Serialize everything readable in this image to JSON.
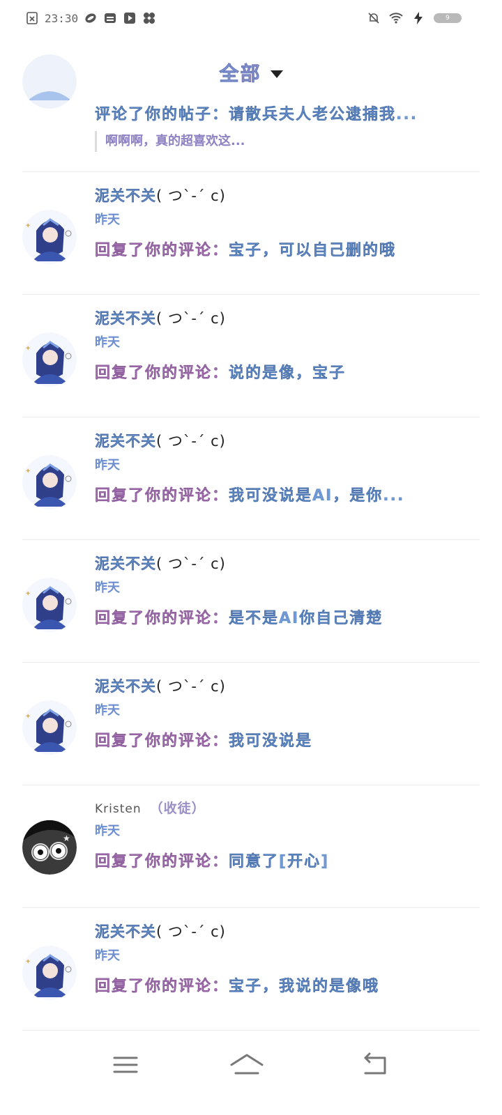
{
  "status_bar": {
    "time": "23:30",
    "left_icons": [
      "sim-x-icon",
      "app-icon",
      "calendar-icon",
      "video-icon",
      "fan-icon"
    ],
    "right_icons": [
      "mute-bell-icon",
      "wifi-icon",
      "charging-icon"
    ],
    "battery_label": "9"
  },
  "header": {
    "title": "全部",
    "back_icon": "chevron-left-icon",
    "dropdown_icon": "caret-down-icon"
  },
  "first_item": {
    "message": "评论了你的帖子：请散兵夫人老公逮捕我...",
    "quote": "啊啊啊，真的超喜欢这..."
  },
  "notifications": [
    {
      "name": "泥关不关",
      "kaomoji": "( つ`-´ c)",
      "time": "昨天",
      "action": "回复了你的评论：",
      "text": "宝子，可以自己删的哦"
    },
    {
      "name": "泥关不关",
      "kaomoji": "( つ`-´ c)",
      "time": "昨天",
      "action": "回复了你的评论：",
      "text": "说的是像，宝子"
    },
    {
      "name": "泥关不关",
      "kaomoji": "( つ`-´ c)",
      "time": "昨天",
      "action": "回复了你的评论：",
      "text": "我可没说是AI，是你..."
    },
    {
      "name": "泥关不关",
      "kaomoji": "( つ`-´ c)",
      "time": "昨天",
      "action": "回复了你的评论：",
      "text": "是不是AI你自己清楚"
    },
    {
      "name": "泥关不关",
      "kaomoji": "( つ`-´ c)",
      "time": "昨天",
      "action": "回复了你的评论：",
      "text": "我可没说是"
    },
    {
      "name": "Kristen",
      "tag": "（收徒）",
      "time": "昨天",
      "action": "回复了你的评论：",
      "text": "同意了[开心]"
    },
    {
      "name": "泥关不关",
      "kaomoji": "( つ`-´ c)",
      "time": "昨天",
      "action": "回复了你的评论：",
      "text": "宝子，我说的是像哦"
    }
  ],
  "nav_bar": {
    "menu_icon": "menu-icon",
    "home_icon": "home-icon",
    "back_icon": "back-arrow-icon"
  },
  "colors": {
    "name_blue": "#7aa2d8",
    "action_purple": "#b37fbf",
    "divider": "#ececec"
  }
}
